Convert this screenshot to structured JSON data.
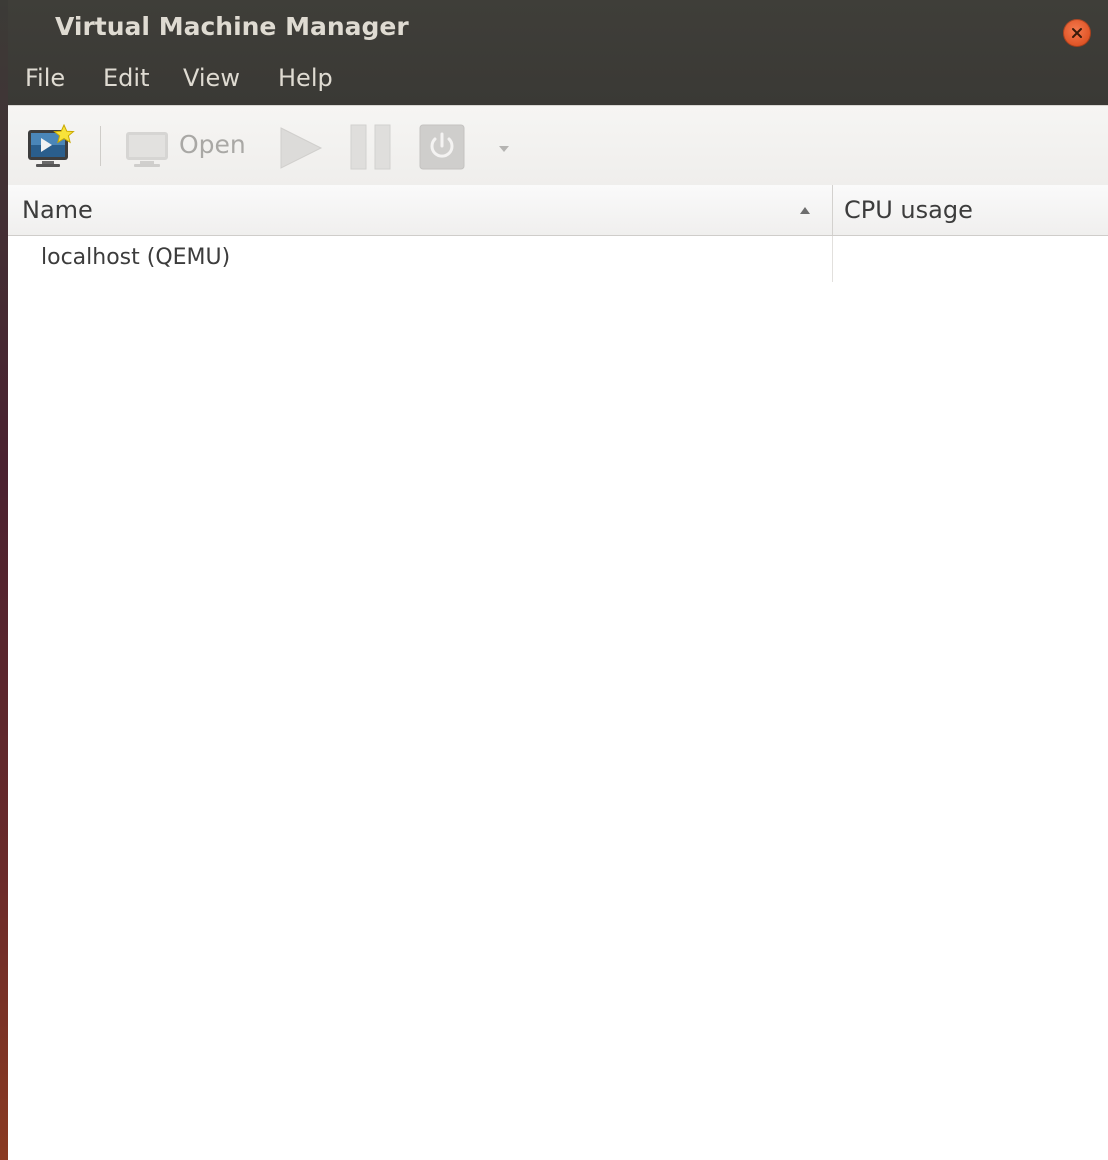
{
  "window": {
    "title": "Virtual Machine Manager"
  },
  "menubar": {
    "items": [
      {
        "label": "File"
      },
      {
        "label": "Edit"
      },
      {
        "label": "View"
      },
      {
        "label": "Help"
      }
    ]
  },
  "toolbar": {
    "new_vm_icon": "new-vm-icon",
    "open_label": "Open",
    "open_enabled": false,
    "run_enabled": false,
    "pause_enabled": false,
    "shutdown_enabled": false
  },
  "table": {
    "columns": [
      {
        "label": "Name",
        "sorted": "ascending"
      },
      {
        "label": "CPU usage"
      }
    ],
    "rows": [
      {
        "name": "localhost (QEMU)",
        "cpu_usage": ""
      }
    ]
  },
  "colors": {
    "header_bg": "#3c3b37",
    "header_text": "#dfdbd2",
    "close_button": "#e2582a",
    "toolbar_bg": "#f2f1f0",
    "disabled_icon": "#cfcecc"
  }
}
